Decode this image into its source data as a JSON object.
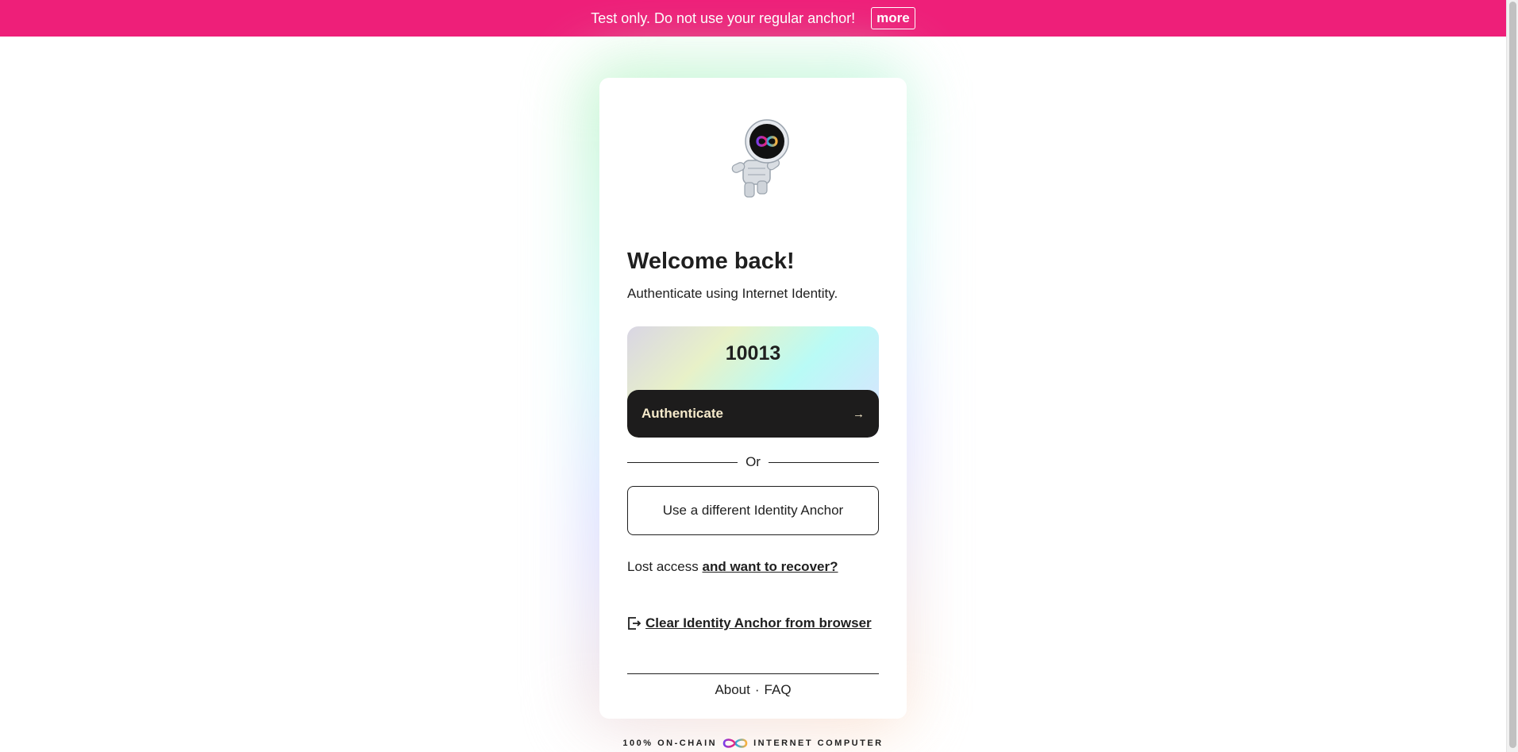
{
  "banner": {
    "message": "Test only. Do not use your regular anchor!",
    "more_label": "more",
    "color": "#ee1f79"
  },
  "card": {
    "mascot_icon": "astronaut-infinity-icon",
    "title": "Welcome back!",
    "subtitle": "Authenticate using Internet Identity.",
    "anchor_number": "10013",
    "authenticate_label": "Authenticate",
    "authenticate_arrow": "→",
    "or_label": "Or",
    "different_anchor_label": "Use a different Identity Anchor",
    "lost_access_text": "Lost access",
    "recover_link": "and want to recover?",
    "clear_icon": "logout-icon",
    "clear_label": "Clear Identity Anchor from browser",
    "footer": {
      "about": "About",
      "separator": "·",
      "faq": "FAQ"
    }
  },
  "footer_brand": {
    "left_text": "100% ON-CHAIN",
    "icon": "infinity-logo-icon",
    "right_text": "INTERNET COMPUTER"
  }
}
